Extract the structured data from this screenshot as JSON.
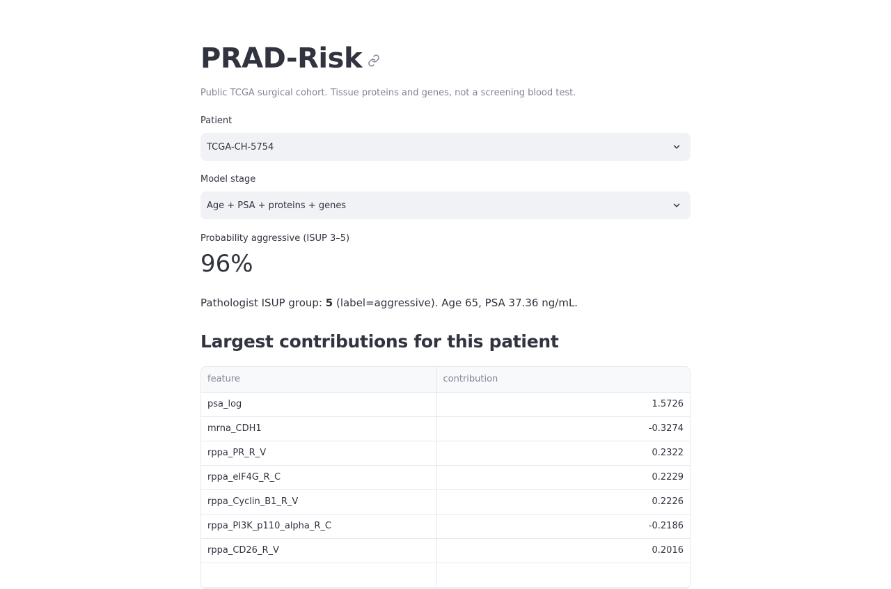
{
  "header": {
    "title": "PRAD-Risk",
    "caption": "Public TCGA surgical cohort. Tissue proteins and genes, not a screening blood test."
  },
  "patient_select": {
    "label": "Patient",
    "value": "TCGA-CH-5754"
  },
  "model_select": {
    "label": "Model stage",
    "value": "Age + PSA + proteins + genes"
  },
  "metric": {
    "label": "Probability aggressive (ISUP 3–5)",
    "value": "96%"
  },
  "summary": {
    "prefix": "Pathologist ISUP group: ",
    "isup_group": "5",
    "suffix": " (label=aggressive). Age 65, PSA 37.36 ng/mL."
  },
  "contributions": {
    "title": "Largest contributions for this patient",
    "columns": [
      "feature",
      "contribution"
    ],
    "rows": [
      {
        "feature": "psa_log",
        "contribution": "1.5726"
      },
      {
        "feature": "mrna_CDH1",
        "contribution": "-0.3274"
      },
      {
        "feature": "rppa_PR_R_V",
        "contribution": "0.2322"
      },
      {
        "feature": "rppa_eIF4G_R_C",
        "contribution": "0.2229"
      },
      {
        "feature": "rppa_Cyclin_B1_R_V",
        "contribution": "0.2226"
      },
      {
        "feature": "rppa_PI3K_p110_alpha_R_C",
        "contribution": "-0.2186"
      },
      {
        "feature": "rppa_CD26_R_V",
        "contribution": "0.2016"
      },
      {
        "feature": "",
        "contribution": ""
      }
    ]
  },
  "icons": {
    "anchor": "link-icon",
    "select_arrow": "chevron-down-icon"
  },
  "colors": {
    "text": "#31333f",
    "muted": "#808495",
    "input_bg": "#f0f2f6",
    "border": "#e6e8ee"
  }
}
